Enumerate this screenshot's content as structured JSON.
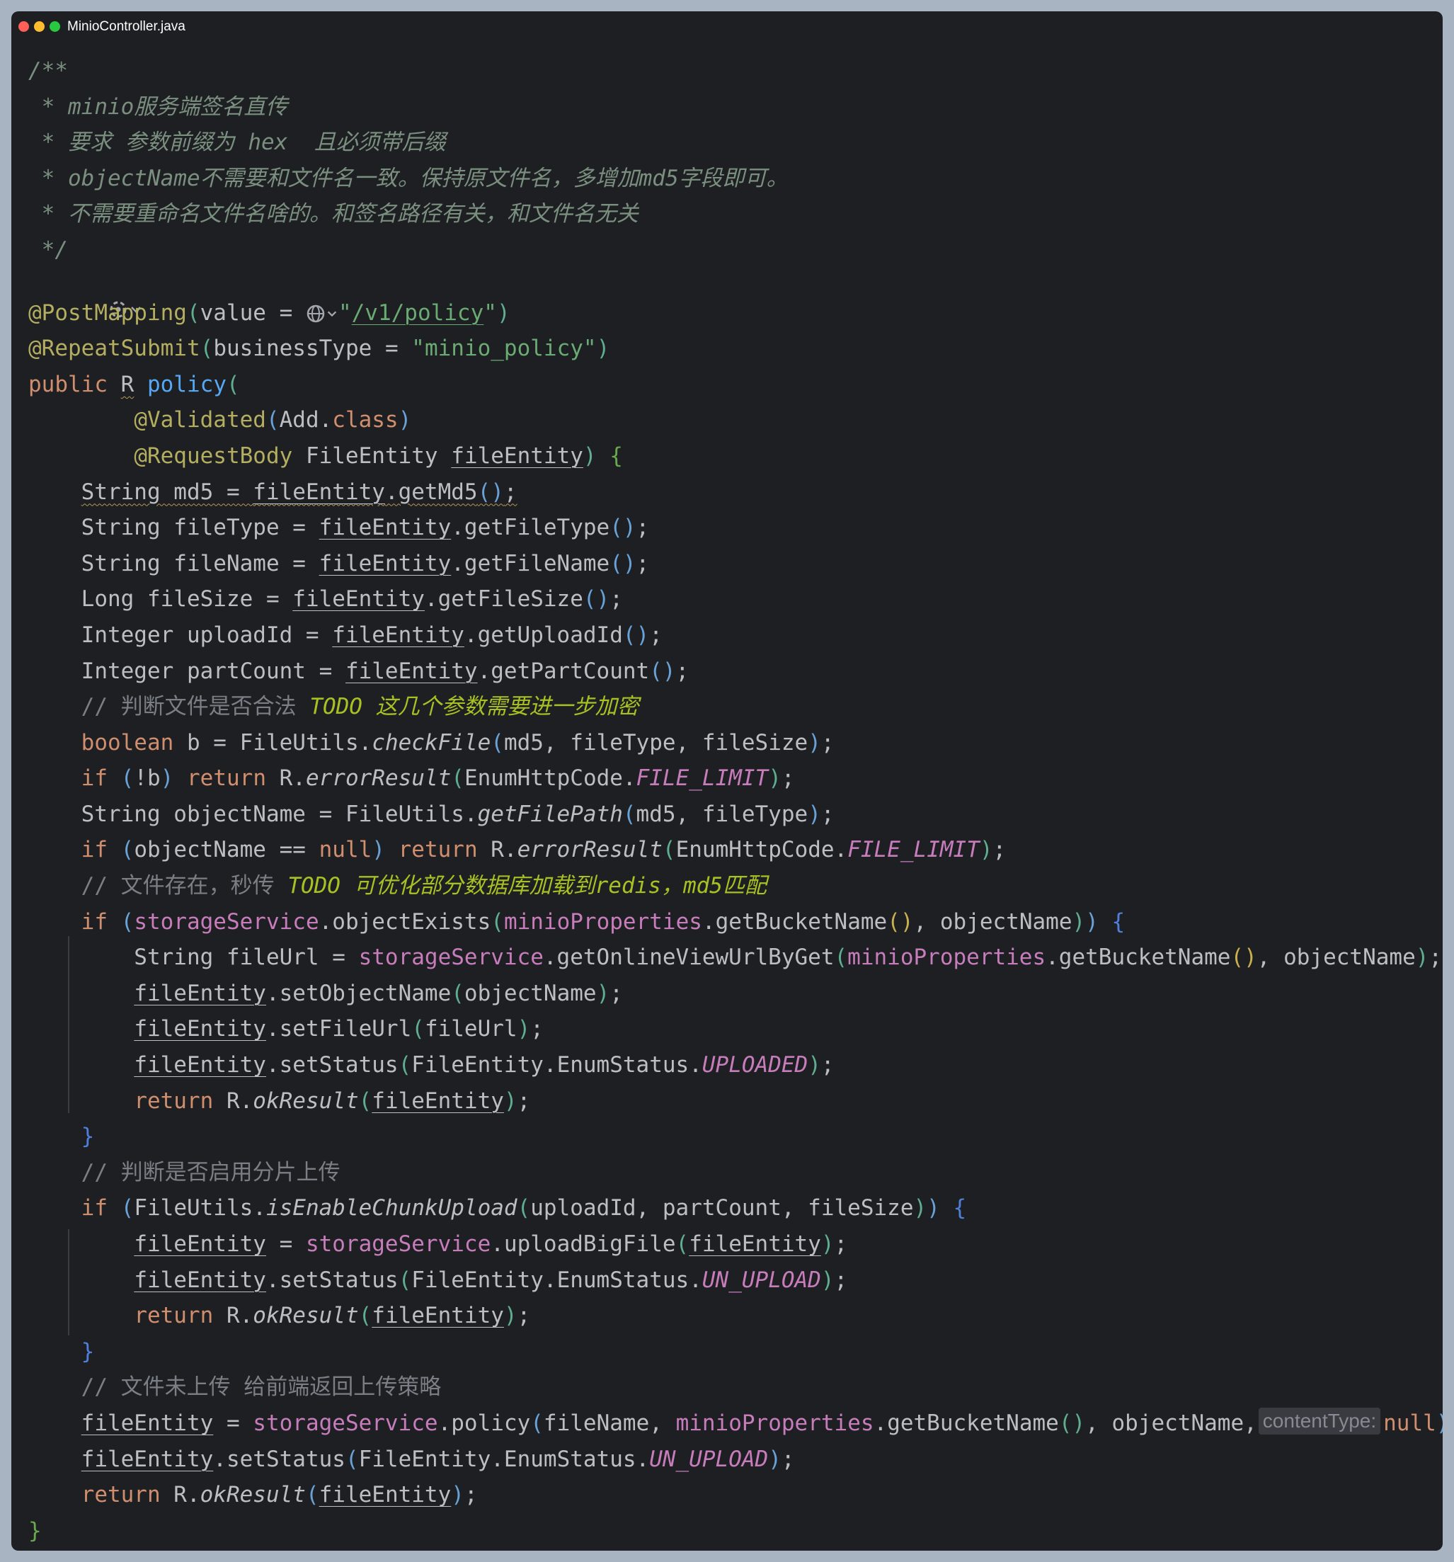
{
  "window": {
    "filename": "MinioController.java"
  },
  "code": {
    "l01": "/**",
    "l02": " * minio服务端签名直传",
    "l03": " * 要求 参数前缀为 hex  且必须带后缀",
    "l04": " * objectName不需要和文件名一致。保持原文件名，多增加md5字段即可。",
    "l05": " * 不需要重命名文件名啥的。和签名路径有关，和文件名无关",
    "l06": " */",
    "post_mapping_path": "/v1/policy",
    "business_type": "minio_policy",
    "c1_prefix": "// 判断文件是否合法 ",
    "c1_todo": "TODO 这几个参数需要进一步加密",
    "c2_prefix": "// 文件存在，秒传 ",
    "c2_todo": "TODO 可优化部分数据库加载到redis，md5匹配",
    "c3": "// 判断是否启用分片上传",
    "c4": "// 文件未上传 给前端返回上传策略",
    "hint_content_type": "contentType:"
  }
}
